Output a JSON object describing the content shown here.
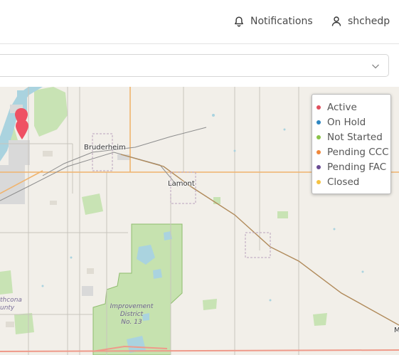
{
  "header": {
    "notifications_label": "Notifications",
    "username": "shchedp"
  },
  "filter": {
    "selected_value": ""
  },
  "map": {
    "place_labels": {
      "bruderheim": "Bruderheim",
      "lamont": "Lamont",
      "edge_right": "M"
    },
    "park_label": "Improvement\nDistrict\nNo. 13",
    "county_label": "thcona\nunty",
    "markers": [
      {
        "status": "Active",
        "color": "#ef5163"
      },
      {
        "status": "Active",
        "color": "#ef5163"
      }
    ]
  },
  "legend": {
    "items": [
      {
        "label": "Active",
        "color": "#e0505e"
      },
      {
        "label": "On Hold",
        "color": "#2e86c1"
      },
      {
        "label": "Not Started",
        "color": "#8bc34a"
      },
      {
        "label": "Pending CCC",
        "color": "#f0883a"
      },
      {
        "label": "Pending FAC",
        "color": "#6a4c93"
      },
      {
        "label": "Closed",
        "color": "#f5c242"
      }
    ]
  }
}
